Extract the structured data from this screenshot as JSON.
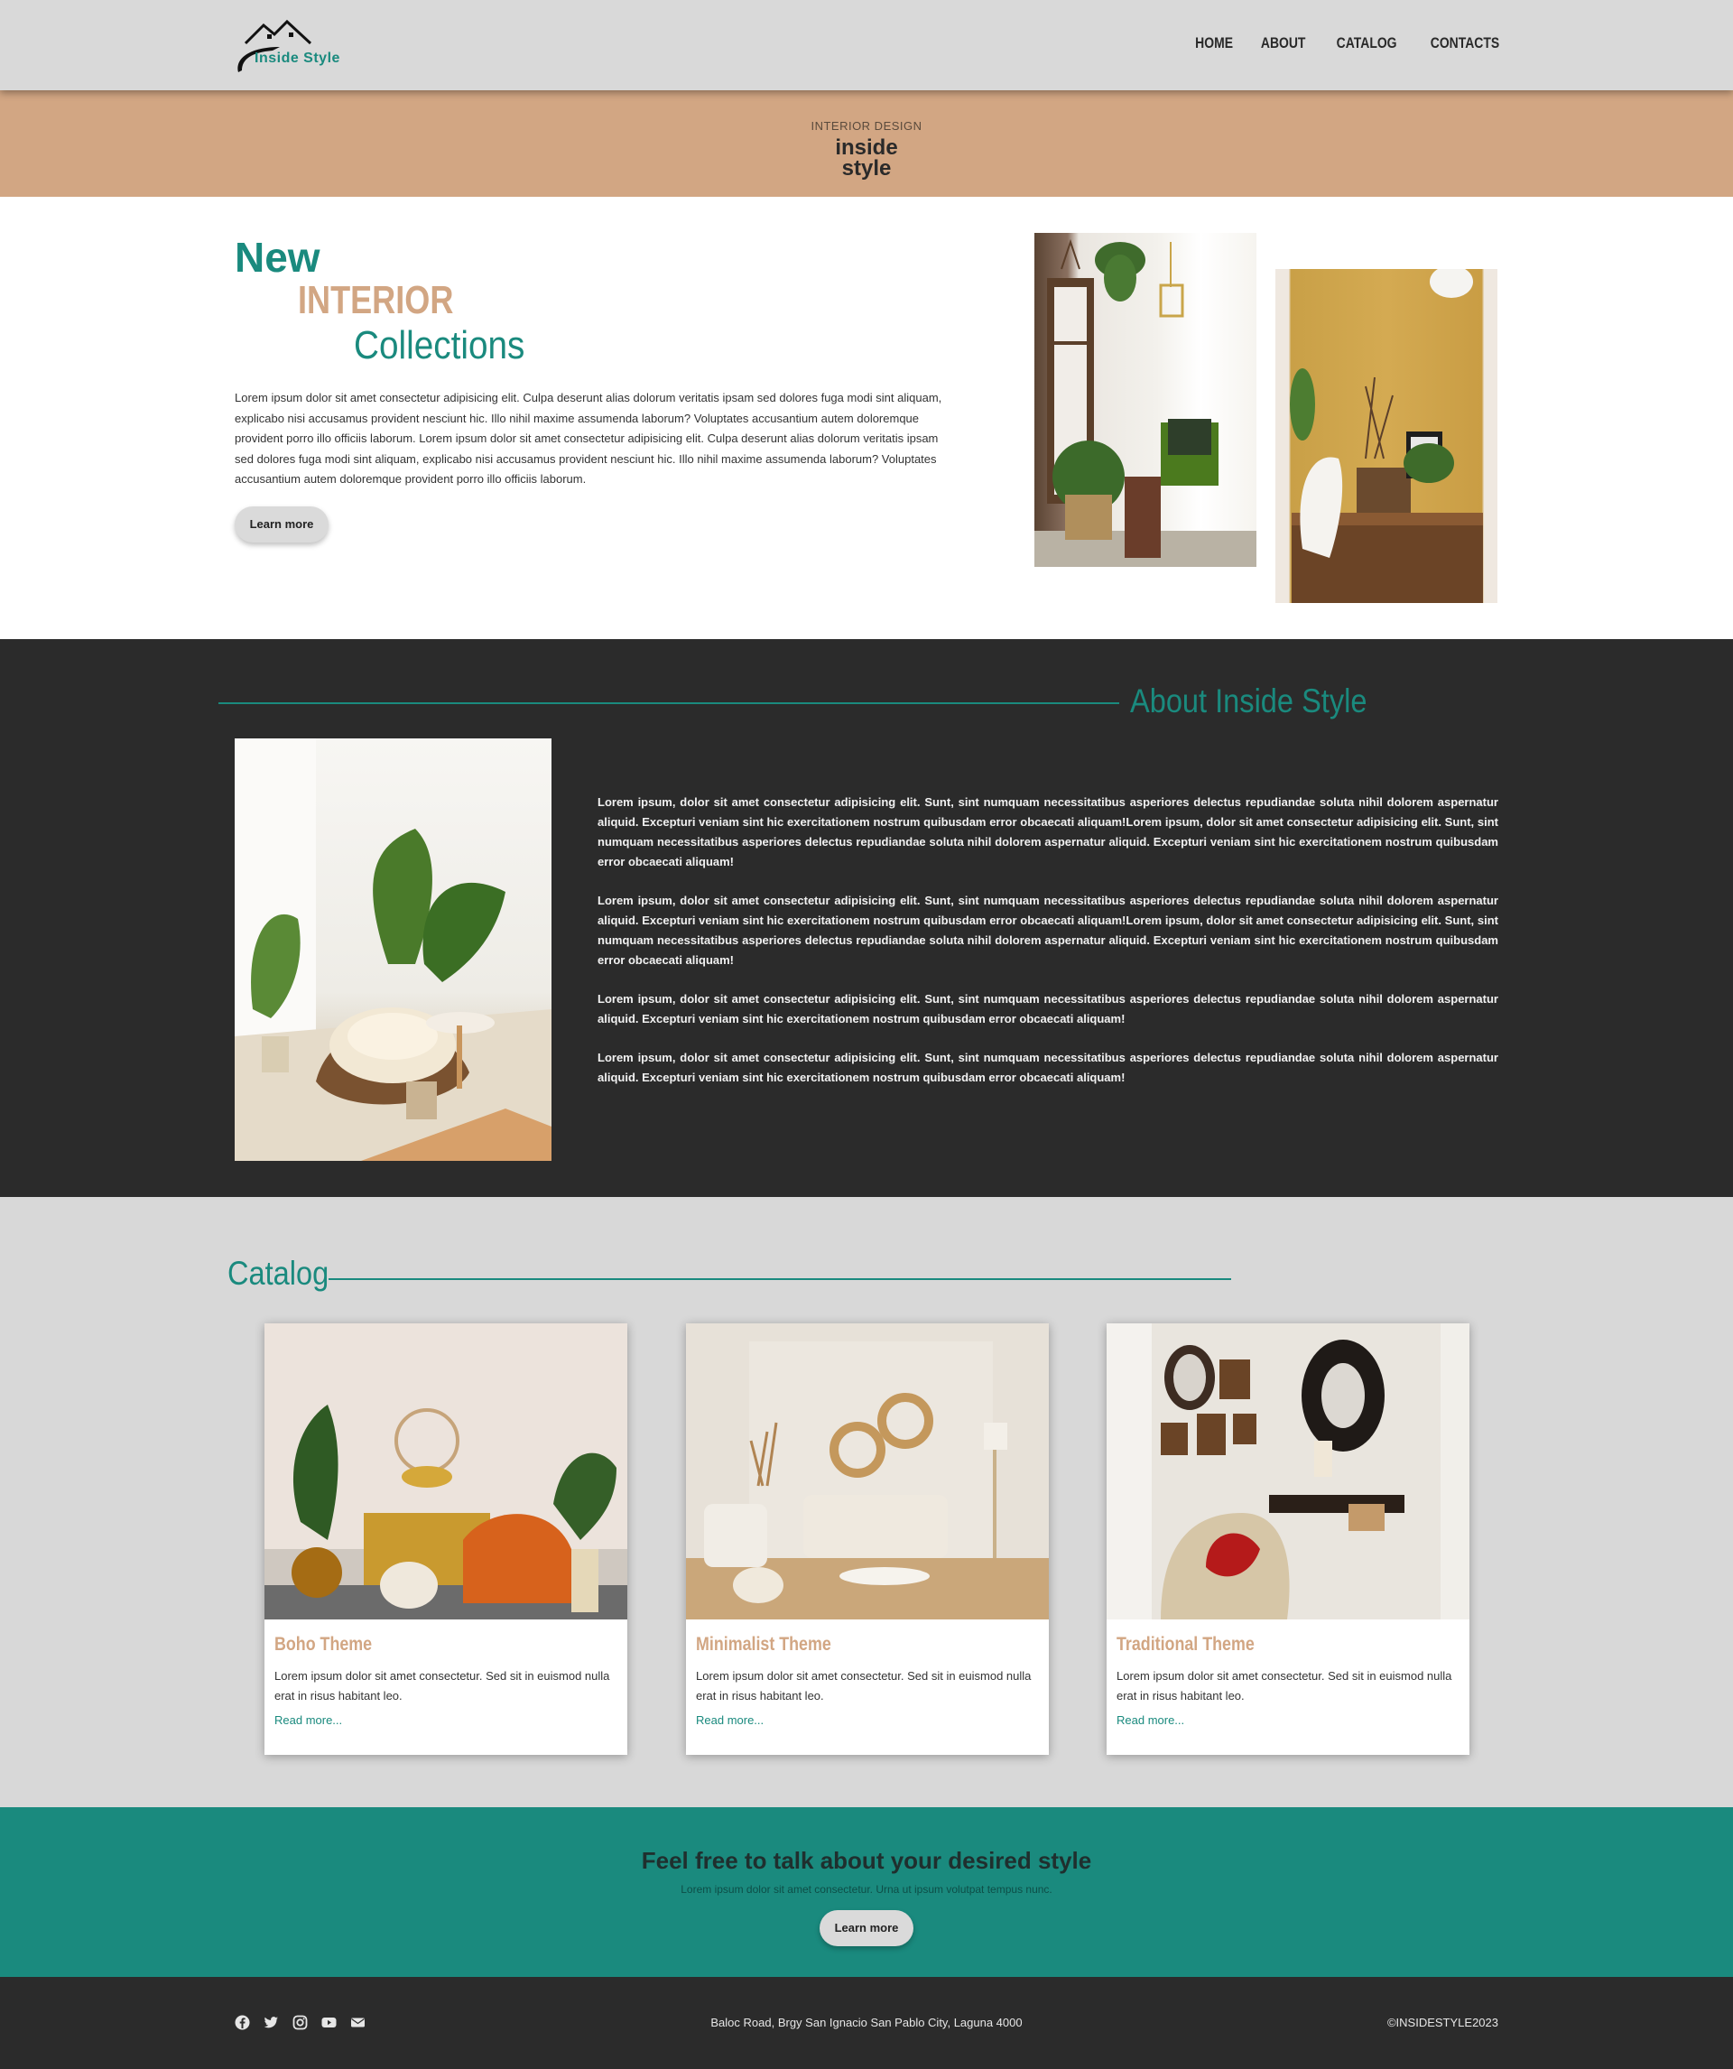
{
  "nav": {
    "logo_text": "Inside Style",
    "links": [
      "HOME",
      "ABOUT",
      "CATALOG",
      "CONTACTS"
    ]
  },
  "banner": {
    "kicker": "INTERIOR DESIGN",
    "title_line1": "inside",
    "title_line2": "style"
  },
  "hero": {
    "heading_line1": "New",
    "heading_line2": "INTERIOR",
    "heading_line3": "Collections",
    "text": "Lorem ipsum dolor sit amet consectetur adipisicing elit. Culpa deserunt alias dolorum veritatis ipsam sed dolores fuga modi sint aliquam, explicabo nisi accusamus provident nesciunt hic. Illo nihil maxime assumenda laborum? Voluptates accusantium autem doloremque provident porro illo officiis laborum. Lorem ipsum dolor sit amet consectetur adipisicing elit. Culpa deserunt alias dolorum veritatis ipsam sed dolores fuga modi sint aliquam, explicabo nisi accusamus provident nesciunt hic. Illo nihil maxime assumenda laborum? Voluptates accusantium autem doloremque provident porro illo officiis laborum.",
    "button_label": "Learn more"
  },
  "about": {
    "title": "About Inside Style",
    "paragraphs": [
      "Lorem ipsum, dolor sit amet consectetur adipisicing elit. Sunt, sint numquam necessitatibus asperiores delectus repudiandae soluta nihil dolorem aspernatur aliquid. Excepturi veniam sint hic exercitationem nostrum quibusdam error obcaecati aliquam!Lorem ipsum, dolor sit amet consectetur adipisicing elit. Sunt, sint numquam necessitatibus asperiores delectus repudiandae soluta nihil dolorem aspernatur aliquid. Excepturi veniam sint hic exercitationem nostrum quibusdam error obcaecati aliquam!",
      "Lorem ipsum, dolor sit amet consectetur adipisicing elit. Sunt, sint numquam necessitatibus asperiores delectus repudiandae soluta nihil dolorem aspernatur aliquid. Excepturi veniam sint hic exercitationem nostrum quibusdam error obcaecati aliquam!Lorem ipsum, dolor sit amet consectetur adipisicing elit. Sunt, sint numquam necessitatibus asperiores delectus repudiandae soluta nihil dolorem aspernatur aliquid. Excepturi veniam sint hic exercitationem nostrum quibusdam error obcaecati aliquam!",
      "Lorem ipsum, dolor sit amet consectetur adipisicing elit. Sunt, sint numquam necessitatibus asperiores delectus repudiandae soluta nihil dolorem aspernatur aliquid. Excepturi veniam sint hic exercitationem nostrum quibusdam error obcaecati aliquam!",
      "Lorem ipsum, dolor sit amet consectetur adipisicing elit. Sunt, sint numquam necessitatibus asperiores delectus repudiandae soluta nihil dolorem aspernatur aliquid. Excepturi veniam sint hic exercitationem nostrum quibusdam error obcaecati aliquam!"
    ]
  },
  "catalog": {
    "title": "Catalog",
    "cards": [
      {
        "title": "Boho Theme",
        "text": "Lorem ipsum dolor sit amet consectetur. Sed sit in euismod nulla erat in risus habitant leo.",
        "link": "Read more..."
      },
      {
        "title": "Minimalist Theme",
        "text": "Lorem ipsum dolor sit amet consectetur. Sed sit in euismod nulla erat in risus habitant leo.",
        "link": "Read more..."
      },
      {
        "title": "Traditional Theme",
        "text": "Lorem ipsum dolor sit amet consectetur. Sed sit in euismod nulla erat in risus habitant leo.",
        "link": "Read more..."
      }
    ]
  },
  "cta": {
    "title": "Feel free to talk about your desired style",
    "subtitle": "Lorem ipsum dolor sit amet consectetur. Urna ut ipsum volutpat tempus nunc.",
    "button_label": "Learn more"
  },
  "footer": {
    "social_icons": [
      "facebook-icon",
      "twitter-icon",
      "instagram-icon",
      "youtube-icon",
      "email-icon"
    ],
    "address": "Baloc Road, Brgy San Ignacio San Pablo City, Laguna 4000",
    "copyright": "©INSIDESTYLE2023"
  },
  "colors": {
    "teal": "#1a8a7e",
    "tan": "#d2a683",
    "dark": "#2b2b2b",
    "light_grey": "#d8d8d8"
  }
}
